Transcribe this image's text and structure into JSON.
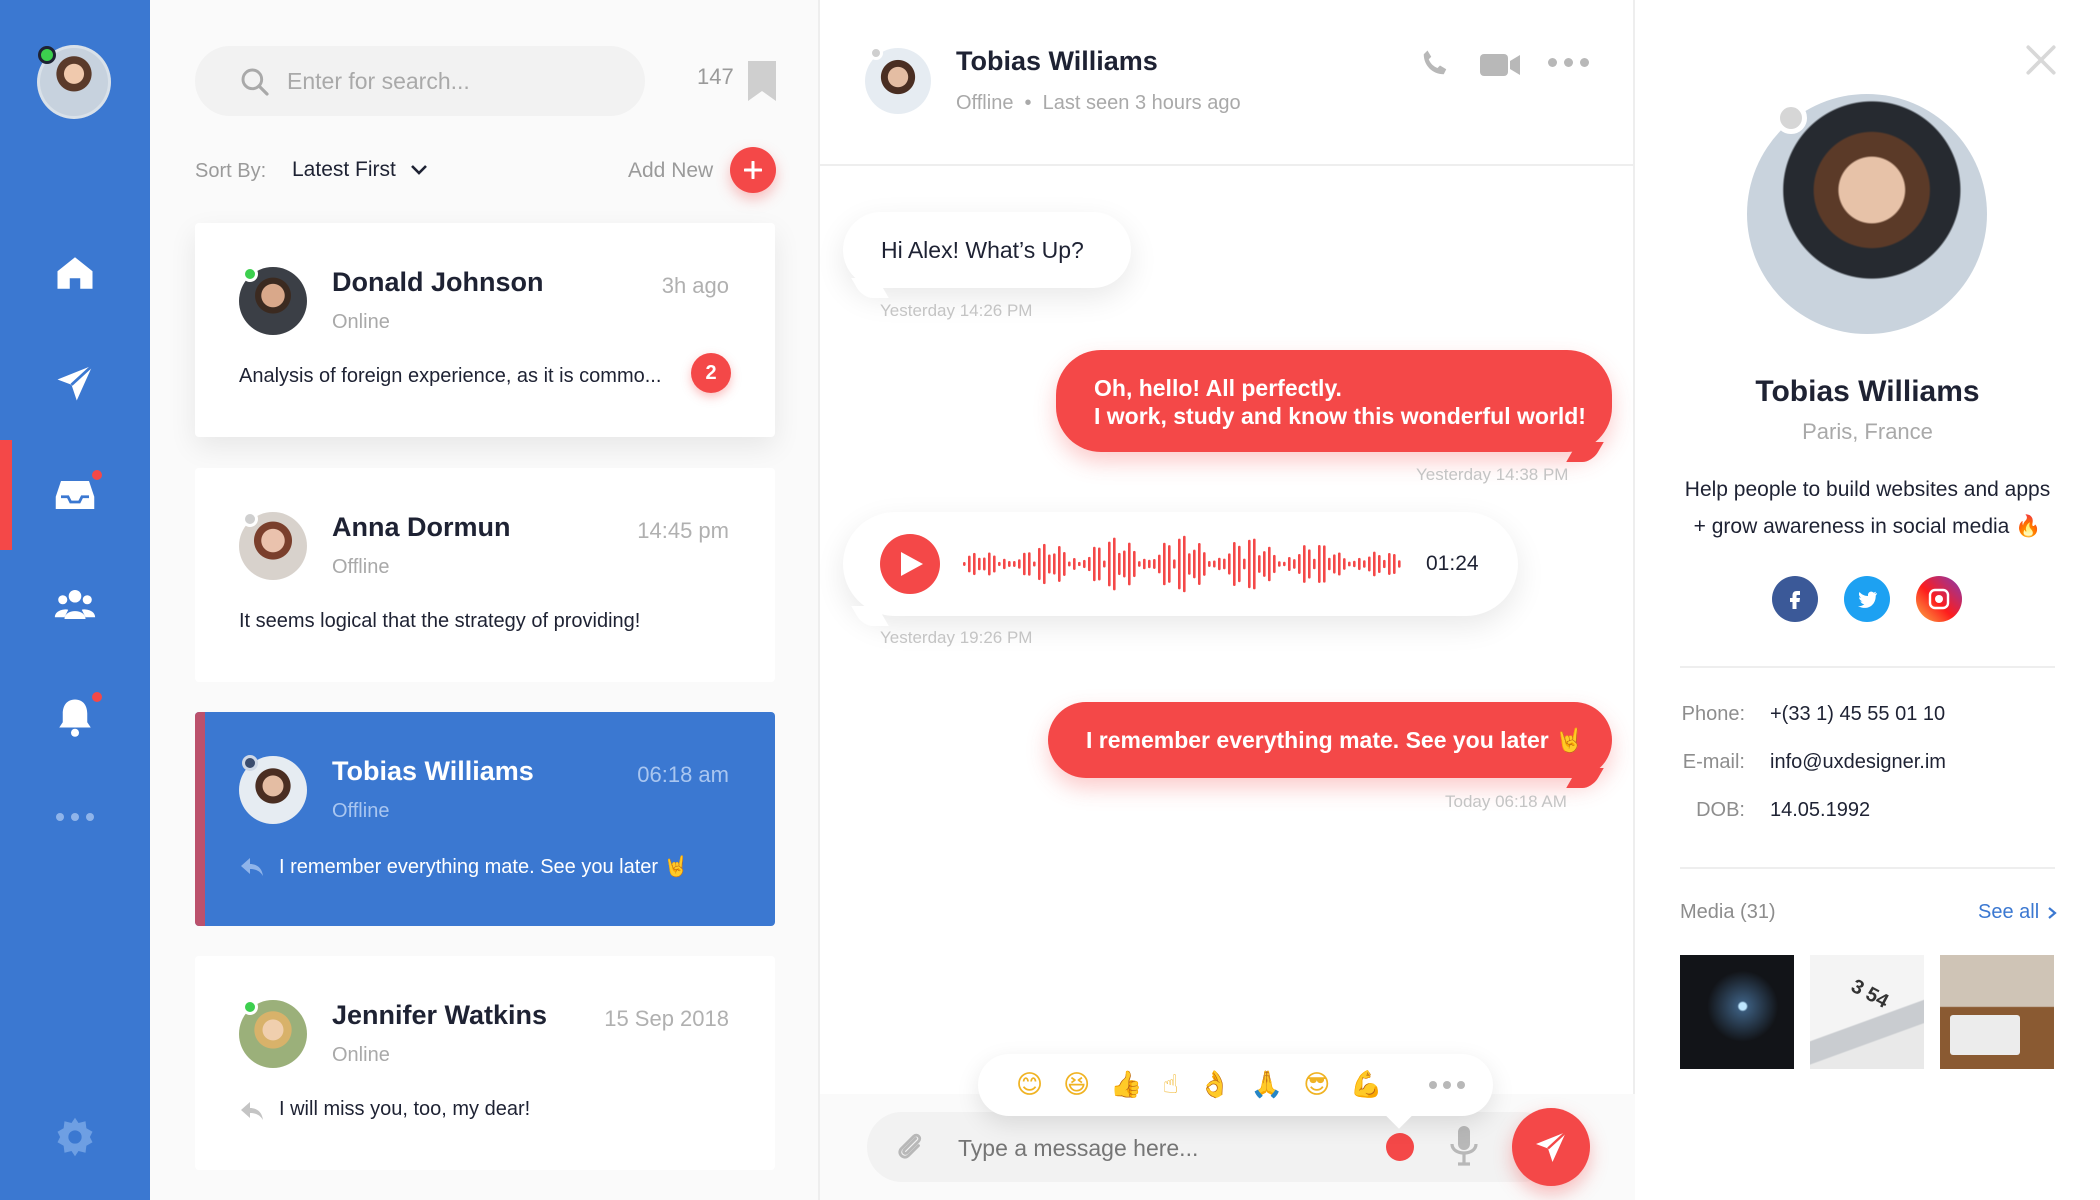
{
  "search": {
    "placeholder": "Enter for search...",
    "count": "147"
  },
  "sort": {
    "label": "Sort By:",
    "value": "Latest First",
    "add_new": "Add New"
  },
  "chats": [
    {
      "name": "Donald Johnson",
      "status": "Online",
      "time": "3h ago",
      "preview": "Analysis of foreign experience, as it is commo...",
      "unread": "2"
    },
    {
      "name": "Anna Dormun",
      "status": "Offline",
      "time": "14:45 pm",
      "preview": "It seems logical that the strategy of providing!"
    },
    {
      "name": "Tobias Williams",
      "status": "Offline",
      "time": "06:18 am",
      "preview": "I remember everything mate. See you later 🤘"
    },
    {
      "name": "Jennifer Watkins",
      "status": "Online",
      "time": "15 Sep 2018",
      "preview": "I will miss you, too, my dear!"
    }
  ],
  "conversation": {
    "name": "Tobias Williams",
    "status": "Offline  •  Last seen 3 hours ago",
    "messages": [
      {
        "text": "Hi Alex! What’s Up?",
        "time": "Yesterday 14:26 PM"
      },
      {
        "line1": "Oh, hello! All perfectly.",
        "line2": "I work, study and know this wonderful world!",
        "time": "Yesterday 14:38 PM"
      },
      {
        "duration": "01:24",
        "time": "Yesterday 19:26 PM"
      },
      {
        "text": "I remember everything mate. See you later 🤘",
        "time": "Today 06:18 AM"
      }
    ]
  },
  "emojis": [
    "😊",
    "😆",
    "👍",
    "☝",
    "👌",
    "🙏",
    "😎",
    "💪"
  ],
  "composer": {
    "placeholder": "Type a message here..."
  },
  "profile": {
    "name": "Tobias Williams",
    "location": "Paris, France",
    "bio_line1": "Help people to build websites and apps",
    "bio_line2": "+ grow awareness in social media",
    "bio_emoji": "🔥",
    "phone_label": "Phone:",
    "phone": "+(33 1) 45 55 01 10",
    "email_label": "E-mail:",
    "email": "info@uxdesigner.im",
    "dob_label": "DOB:",
    "dob": "14.05.1992",
    "media_label": "Media (31)",
    "see_all": "See all"
  },
  "colors": {
    "primary": "#3b78d1",
    "accent": "#f44848",
    "online": "#3ccf4e",
    "offline": "#cfcfcf"
  },
  "icons": [
    "home-icon",
    "send-icon",
    "inbox-icon",
    "users-icon",
    "bell-icon",
    "more-icon",
    "gear-icon",
    "search-icon",
    "bookmark-icon",
    "chevron-down-icon",
    "plus-icon",
    "phone-icon",
    "video-icon",
    "play-icon",
    "attach-icon",
    "microphone-icon",
    "close-icon",
    "facebook-icon",
    "twitter-icon",
    "instagram-icon",
    "chevron-right-icon",
    "reply-icon"
  ]
}
